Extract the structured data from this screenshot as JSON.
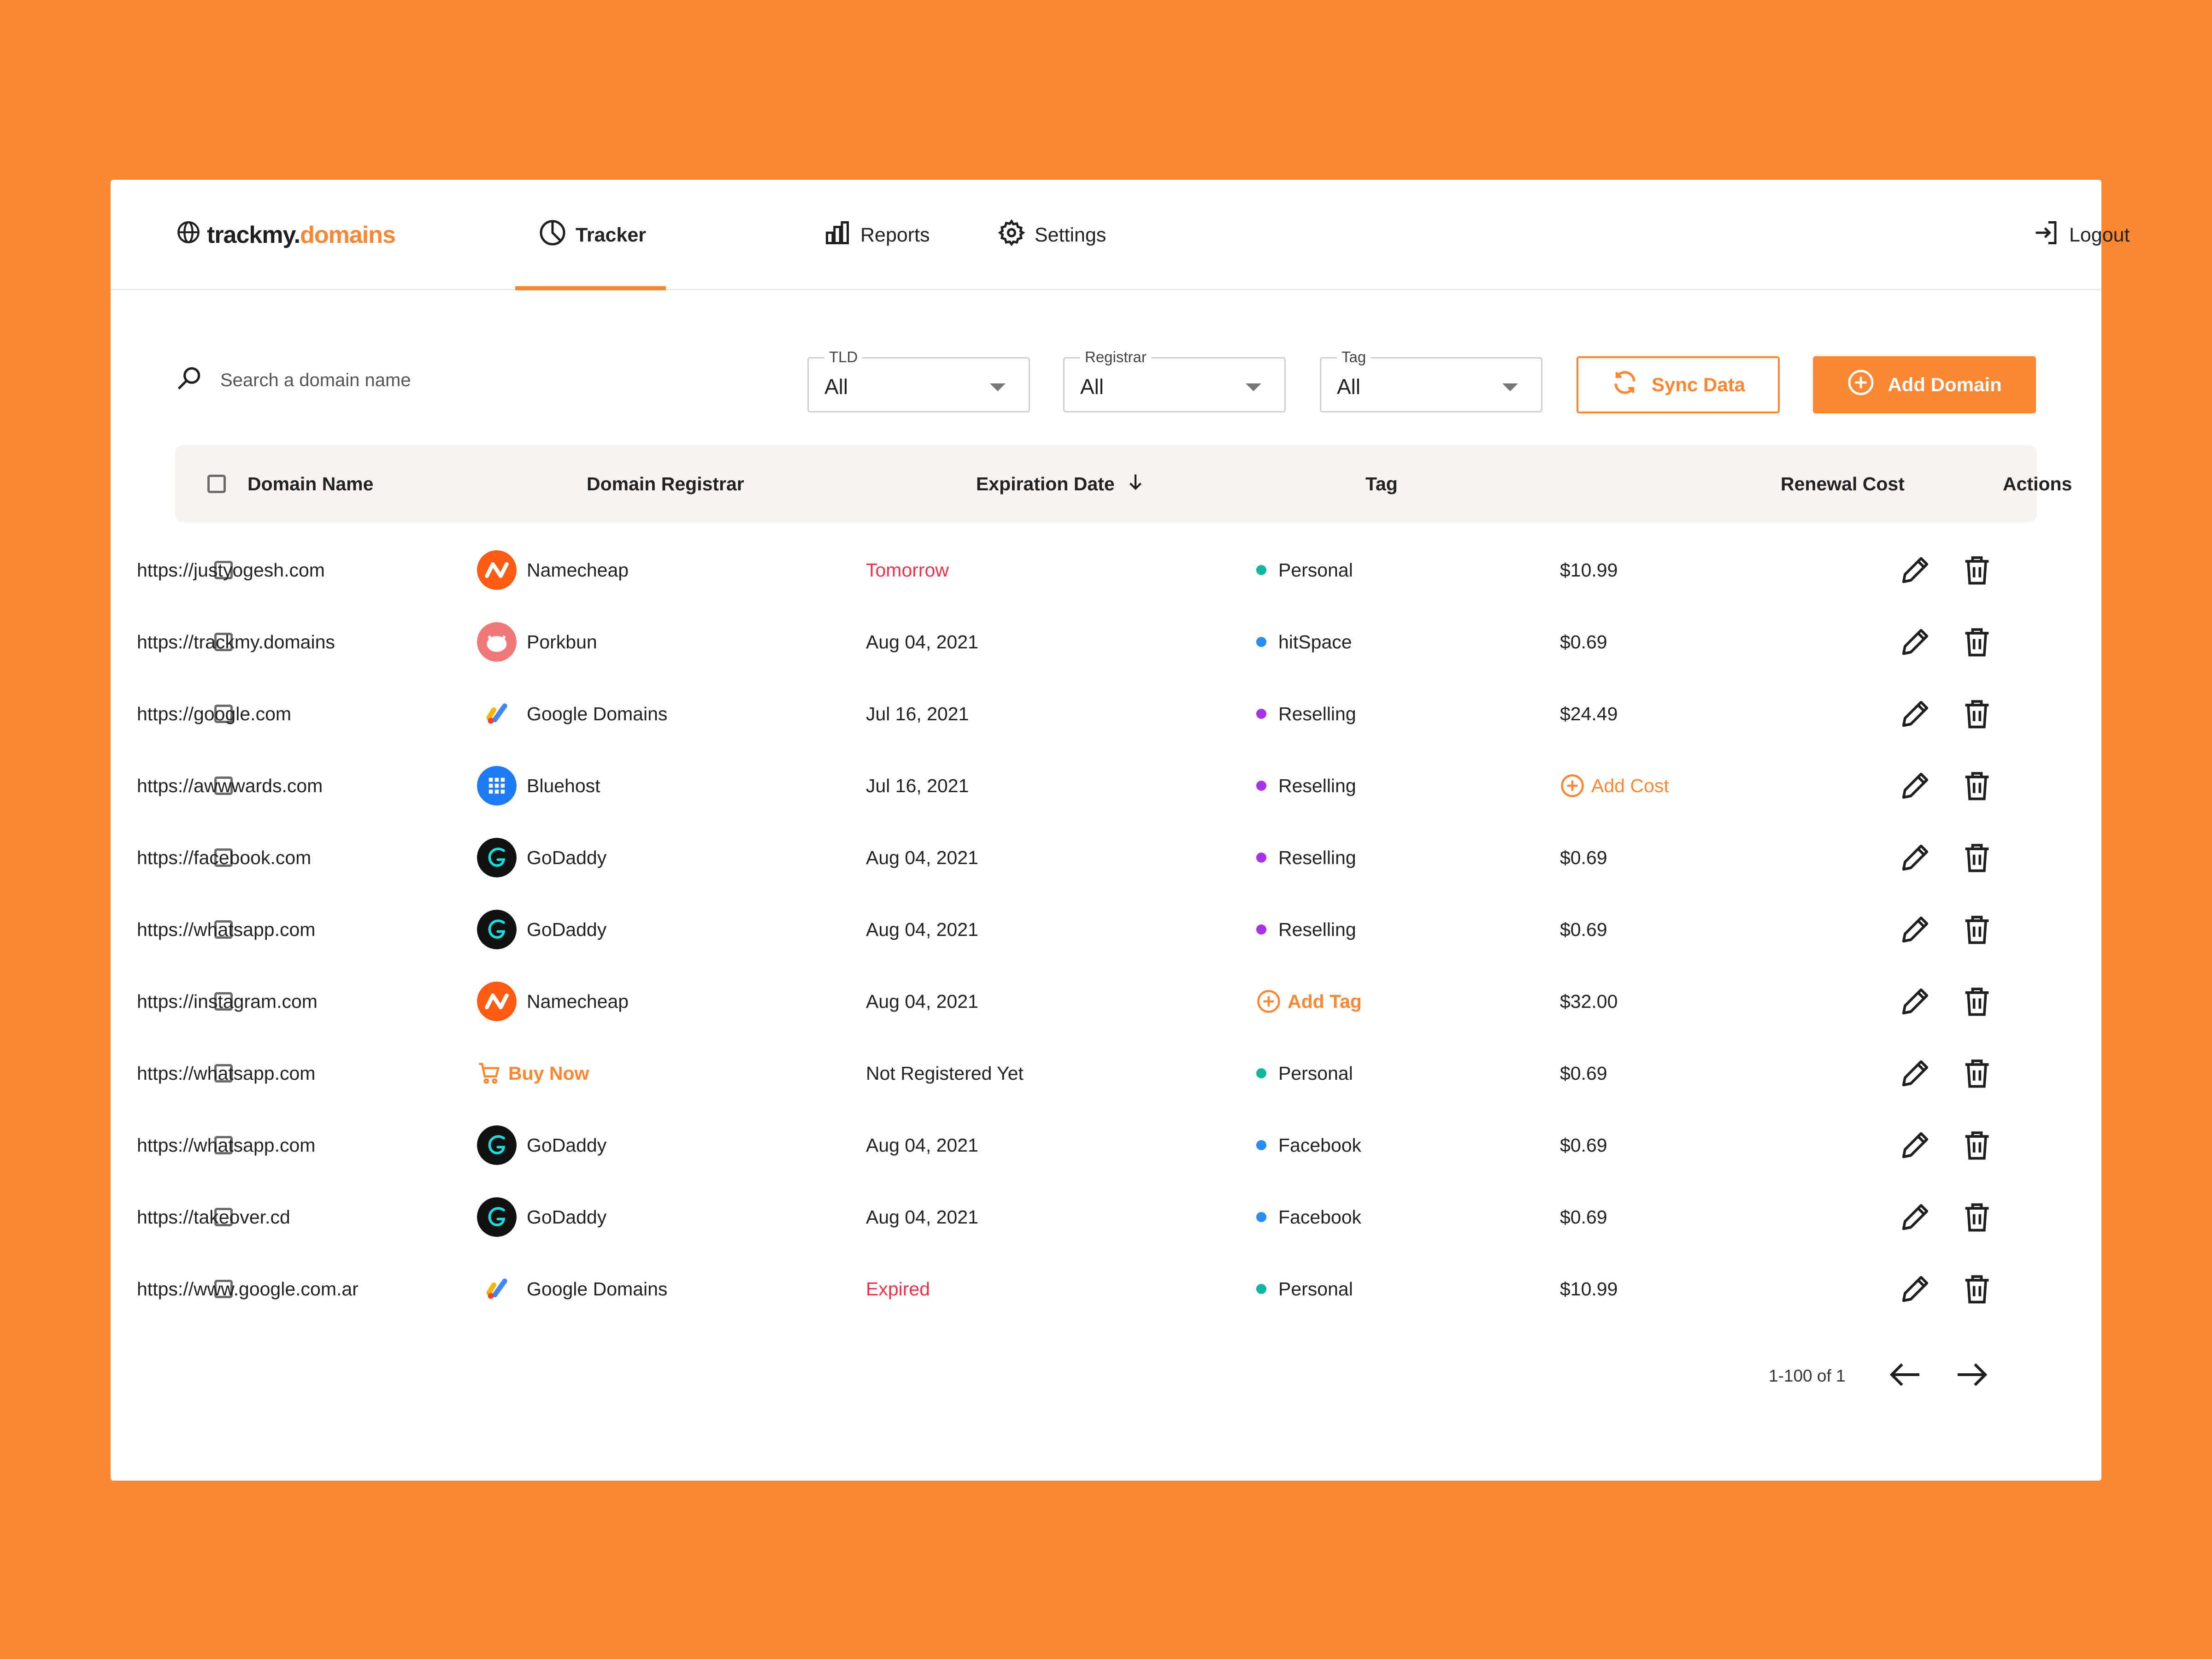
{
  "brand": {
    "name_prefix": "trackmy.",
    "name_suffix": "domains"
  },
  "nav": {
    "items": [
      {
        "label": "Tracker",
        "icon": "pie-chart-icon",
        "active": true
      },
      {
        "label": "Reports",
        "icon": "bar-chart-icon",
        "active": false
      },
      {
        "label": "Settings",
        "icon": "gear-icon",
        "active": false
      }
    ],
    "logout_label": "Logout"
  },
  "toolbar": {
    "search_placeholder": "Search a domain name",
    "filters": [
      {
        "legend": "TLD",
        "value": "All"
      },
      {
        "legend": "Registrar",
        "value": "All"
      },
      {
        "legend": "Tag",
        "value": "All"
      }
    ],
    "sync_label": "Sync Data",
    "add_label": "Add Domain"
  },
  "table": {
    "columns": [
      "Domain Name",
      "Domain Registrar",
      "Expiration Date",
      "Tag",
      "Renewal Cost",
      "Actions"
    ],
    "rows": [
      {
        "domain": "https://justyogesh.com",
        "registrar": "Namecheap",
        "expiry": "Tomorrow",
        "tag": "Personal",
        "cost": "$10.99"
      },
      {
        "domain": "https://trackmy.domains",
        "registrar": "Porkbun",
        "expiry": "Aug 04, 2021",
        "tag": "hitSpace",
        "cost": "$0.69"
      },
      {
        "domain": "https://google.com",
        "registrar": "Google Domains",
        "expiry": "Jul 16, 2021",
        "tag": "Reselling",
        "cost": "$24.49"
      },
      {
        "domain": "https://awwwards.com",
        "registrar": "Bluehost",
        "expiry": "Jul 16, 2021",
        "tag": "Reselling",
        "cost": "Add Cost"
      },
      {
        "domain": "https://facebook.com",
        "registrar": "GoDaddy",
        "expiry": "Aug 04, 2021",
        "tag": "Reselling",
        "cost": "$0.69"
      },
      {
        "domain": "https://whatsapp.com",
        "registrar": "GoDaddy",
        "expiry": "Aug 04, 2021",
        "tag": "Reselling",
        "cost": "$0.69"
      },
      {
        "domain": "https://instagram.com",
        "registrar": "Namecheap",
        "expiry": "Aug 04, 2021",
        "tag": "Add Tag",
        "cost": "$32.00"
      },
      {
        "domain": "https://whatsapp.com",
        "registrar": "Buy Now",
        "expiry": "Not Registered Yet",
        "tag": "Personal",
        "cost": "$0.69"
      },
      {
        "domain": "https://whatsapp.com",
        "registrar": "GoDaddy",
        "expiry": "Aug 04, 2021",
        "tag": "Facebook",
        "cost": "$0.69"
      },
      {
        "domain": "https://takeover.cd",
        "registrar": "GoDaddy",
        "expiry": "Aug 04, 2021",
        "tag": "Facebook",
        "cost": "$0.69"
      },
      {
        "domain": "https://www.google.com.ar",
        "registrar": "Google Domains",
        "expiry": "Expired",
        "tag": "Personal",
        "cost": "$10.99"
      }
    ]
  },
  "pagination": {
    "range": "1-100 of 1"
  },
  "colors": {
    "accent": "#FA8733",
    "danger": "#E8334E",
    "tag_personal": "#12B5A0",
    "tag_hitspace": "#2B8DF0",
    "tag_reselling": "#A733E8",
    "tag_facebook": "#2B8DF0",
    "namecheap": "#FF5B14",
    "porkbun": "#EF7878",
    "bluehost": "#1E7BF2",
    "godaddy": "#111111"
  }
}
